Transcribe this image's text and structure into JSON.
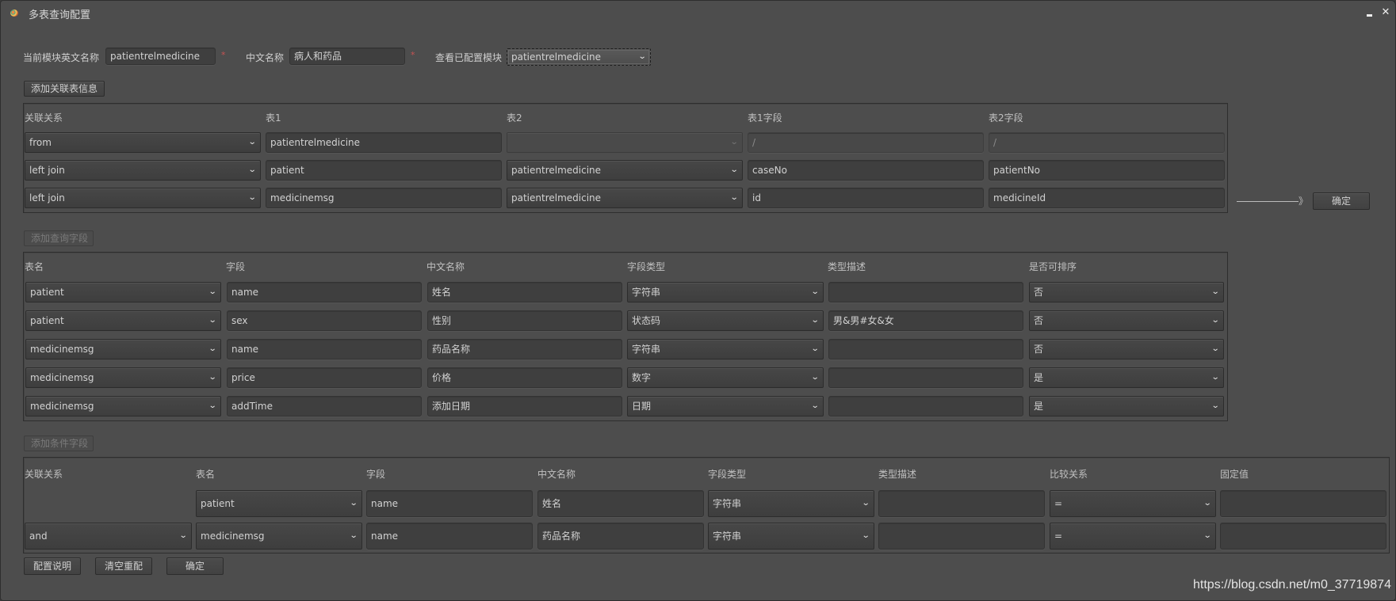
{
  "window": {
    "title": "多表查询配置",
    "icon": "palette-icon",
    "minimize_icon": "minimize-icon",
    "close_icon": "close-icon",
    "close_glyph": "✕"
  },
  "top_form": {
    "module_en_label": "当前模块英文名称",
    "module_en_value": "patientrelmedicine",
    "module_cn_label": "中文名称",
    "module_cn_value": "病人和药品",
    "required_mark": "*",
    "view_configured_label": "查看已配置模块",
    "view_configured_value": "patientrelmedicine"
  },
  "chevron_glyph": "⌄",
  "join_section": {
    "add_button": "添加关联表信息",
    "headers": [
      "关联关系",
      "表1",
      "表2",
      "表1字段",
      "表2字段"
    ],
    "rows": [
      {
        "relation": "from",
        "table1": "patientrelmedicine",
        "table2": "",
        "field1": "/",
        "field2": "/",
        "disabled": true
      },
      {
        "relation": "left join",
        "table1": "patient",
        "table2": "patientrelmedicine",
        "field1": "caseNo",
        "field2": "patientNo",
        "disabled": false
      },
      {
        "relation": "left join",
        "table1": "medicinemsg",
        "table2": "patientrelmedicine",
        "field1": "id",
        "field2": "medicineId",
        "disabled": false
      }
    ],
    "arrow_glyph": "》",
    "confirm_button": "确定"
  },
  "query_section": {
    "add_button": "添加查询字段",
    "headers": [
      "表名",
      "字段",
      "中文名称",
      "字段类型",
      "类型描述",
      "是否可排序"
    ],
    "rows": [
      {
        "table": "patient",
        "field": "name",
        "cn_name": "姓名",
        "type": "字符串",
        "type_desc": "",
        "sortable": "否"
      },
      {
        "table": "patient",
        "field": "sex",
        "cn_name": "性别",
        "type": "状态码",
        "type_desc": "男&男#女&女",
        "sortable": "否"
      },
      {
        "table": "medicinemsg",
        "field": "name",
        "cn_name": "药品名称",
        "type": "字符串",
        "type_desc": "",
        "sortable": "否"
      },
      {
        "table": "medicinemsg",
        "field": "price",
        "cn_name": "价格",
        "type": "数字",
        "type_desc": "",
        "sortable": "是"
      },
      {
        "table": "medicinemsg",
        "field": "addTime",
        "cn_name": "添加日期",
        "type": "日期",
        "type_desc": "",
        "sortable": "是"
      }
    ]
  },
  "condition_section": {
    "add_button": "添加条件字段",
    "headers": [
      "关联关系",
      "表名",
      "字段",
      "中文名称",
      "字段类型",
      "类型描述",
      "比较关系",
      "固定值"
    ],
    "rows": [
      {
        "relation": null,
        "table": "patient",
        "field": "name",
        "cn_name": "姓名",
        "type": "字符串",
        "type_desc": "",
        "compare": "=",
        "fixed_value": ""
      },
      {
        "relation": "and",
        "table": "medicinemsg",
        "field": "name",
        "cn_name": "药品名称",
        "type": "字符串",
        "type_desc": "",
        "compare": "=",
        "fixed_value": ""
      }
    ]
  },
  "footer": {
    "help_button": "配置说明",
    "reset_button": "清空重配",
    "confirm_button": "确定"
  },
  "watermark": "https://blog.csdn.net/m0_37719874"
}
